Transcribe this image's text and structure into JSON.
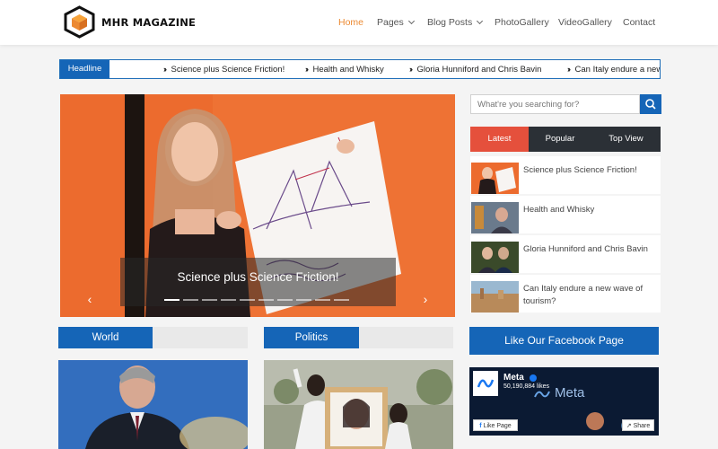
{
  "brand": {
    "name": "MHR MAGAZINE",
    "accent": "#ec8a33",
    "primary": "#1565b7"
  },
  "nav": {
    "items": [
      {
        "label": "Home",
        "active": true
      },
      {
        "label": "Pages",
        "dropdown": true
      },
      {
        "label": "Blog Posts",
        "dropdown": true
      },
      {
        "label": "PhotoGallery"
      },
      {
        "label": "VideoGallery"
      },
      {
        "label": "Contact"
      }
    ]
  },
  "ticker": {
    "label": "Headline",
    "items": [
      "Science plus Science Friction!",
      "Health and Whisky",
      "Gloria Hunniford and Chris Bavin",
      "Can Italy endure a new wave of tourism?"
    ]
  },
  "slider": {
    "caption": "Science plus Science Friction!",
    "slide_count": 10,
    "active_slide": 1,
    "prev_icon": "chevron-left-icon",
    "next_icon": "chevron-right-icon"
  },
  "sections": {
    "world": {
      "label": "World"
    },
    "politics": {
      "label": "Politics"
    }
  },
  "sidebar": {
    "search": {
      "placeholder": "What're you searching for?",
      "icon": "search-icon"
    },
    "tabs": [
      {
        "label": "Latest",
        "active": true
      },
      {
        "label": "Popular"
      },
      {
        "label": "Top View"
      }
    ],
    "latest": [
      {
        "title": "Science plus Science Friction!"
      },
      {
        "title": "Health and Whisky"
      },
      {
        "title": "Gloria Hunniford and Chris Bavin"
      },
      {
        "title": "Can Italy endure a new wave of tourism?"
      }
    ],
    "facebook": {
      "heading": "Like Our Facebook Page",
      "page_name": "Meta",
      "likes": "50,190,884 likes",
      "like_label": "Like Page",
      "share_label": "Share",
      "cover_text": "Meta"
    }
  }
}
